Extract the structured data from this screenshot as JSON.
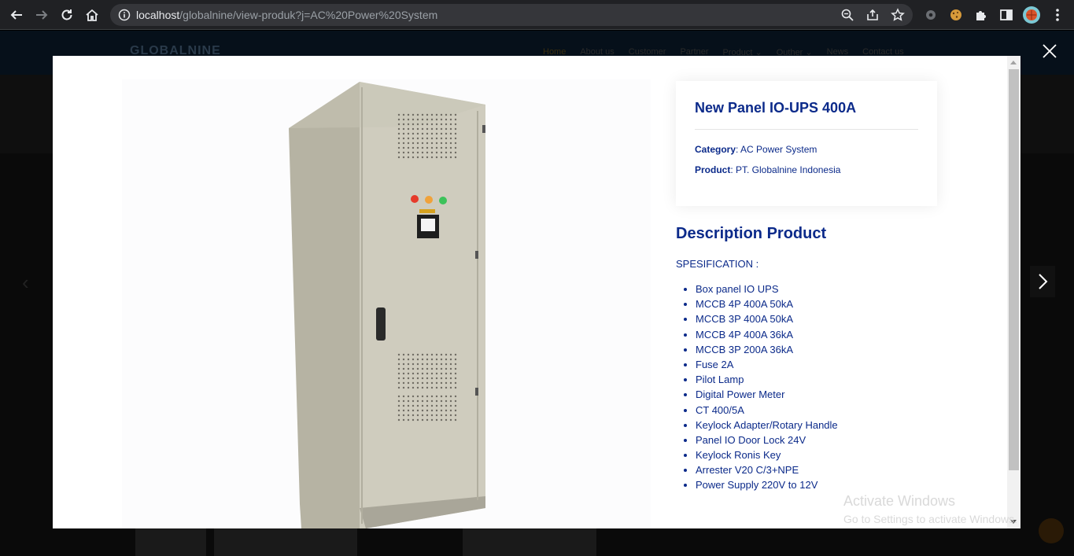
{
  "browser": {
    "url_host": "localhost",
    "url_path": "/globalnine/view-produk?j=AC%20Power%20System"
  },
  "site": {
    "logo": "GLOBALNINE",
    "nav": [
      "Home",
      "About us",
      "Customer",
      "Partner",
      "Product ⌄",
      "Outher ⌄",
      "News",
      "Contact us"
    ]
  },
  "product": {
    "title": "New Panel IO-UPS 400A",
    "category_label": "Category",
    "category_value": ": AC Power System",
    "product_label": "Product",
    "product_value": ": PT. Globalnine Indonesia",
    "description_title": "Description Product",
    "spec_label": "SPESIFICATION :",
    "specs": [
      "Box panel IO UPS",
      "MCCB 4P 400A 50kA",
      "MCCB 3P 400A 50kA",
      "MCCB 4P 400A 36kA",
      "MCCB 3P 200A 36kA",
      "Fuse 2A",
      "Pilot Lamp",
      "Digital Power Meter",
      "CT 400/5A",
      "Keylock Adapter/Rotary Handle",
      "Panel IO Door Lock 24V",
      "Keylock Ronis Key",
      "Arrester V20 C/3+NPE",
      "Power Supply 220V to 12V"
    ]
  },
  "watermark": {
    "line1": "Activate Windows",
    "line2": "Go to Settings to activate Windows."
  }
}
